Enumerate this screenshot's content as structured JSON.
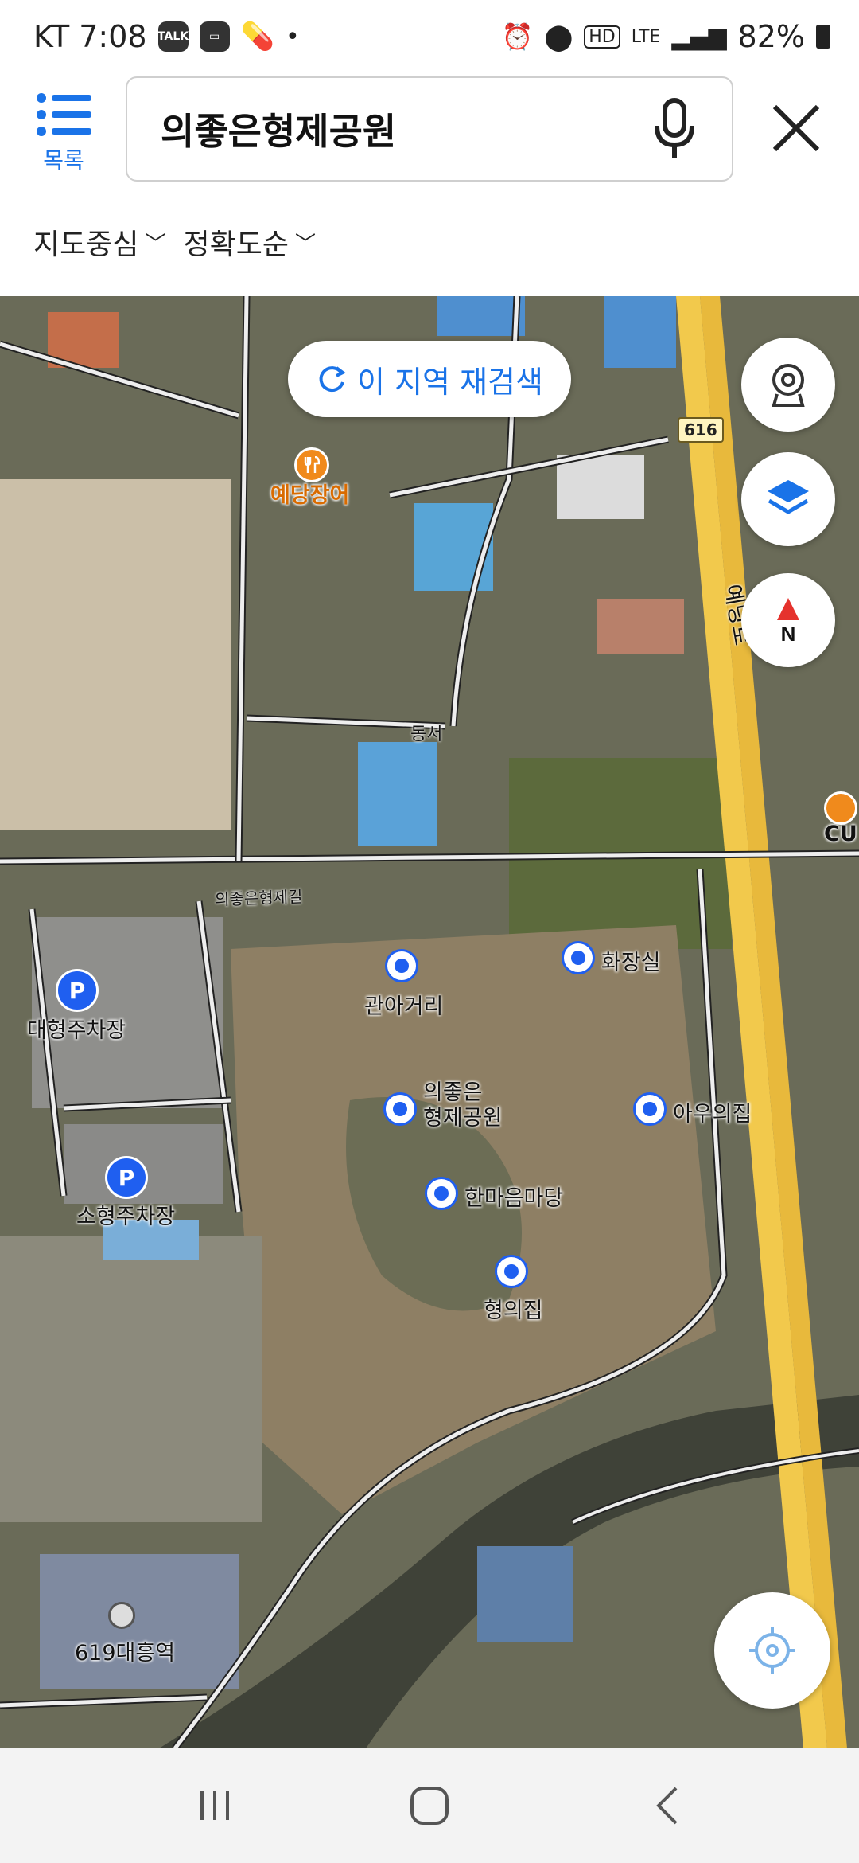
{
  "status_bar": {
    "carrier_time": "KT 7:08",
    "talk_label": "TALK",
    "network": "LTE",
    "hd": "HD",
    "battery": "82%"
  },
  "header": {
    "menu_label": "목록",
    "search_query": "의좋은형제공원",
    "filter_center": "지도중심",
    "filter_sort": "정확도순"
  },
  "map": {
    "research_button": "이 지역 재검색",
    "route_badge": "616",
    "road_main": "예당로",
    "road_east_west": "동서",
    "road_uijong": "의좋은형제길",
    "store_cu": "CU",
    "places": {
      "yedang_eel": "예당장어",
      "big_parking": "대형주차장",
      "small_parking": "소형주차장",
      "gwana": "관아거리",
      "park_line1": "의좋은",
      "park_line2": "형제공원",
      "toilet": "화장실",
      "younger_house": "아우의집",
      "hanmaeum": "한마음마당",
      "elder_house": "형의집",
      "station": "619대흥역"
    }
  },
  "colors": {
    "accent": "#1a73e8",
    "pin_blue": "#1f5ff0",
    "food_orange": "#f08a1c",
    "road_yellow": "#f2c94c"
  },
  "icons": {
    "menu": "list-icon",
    "mic": "microphone-icon",
    "close": "close-icon",
    "refresh": "refresh-icon",
    "street_view": "street-view-icon",
    "layers": "layers-icon",
    "compass": "compass-icon",
    "locate": "location-target-icon"
  }
}
